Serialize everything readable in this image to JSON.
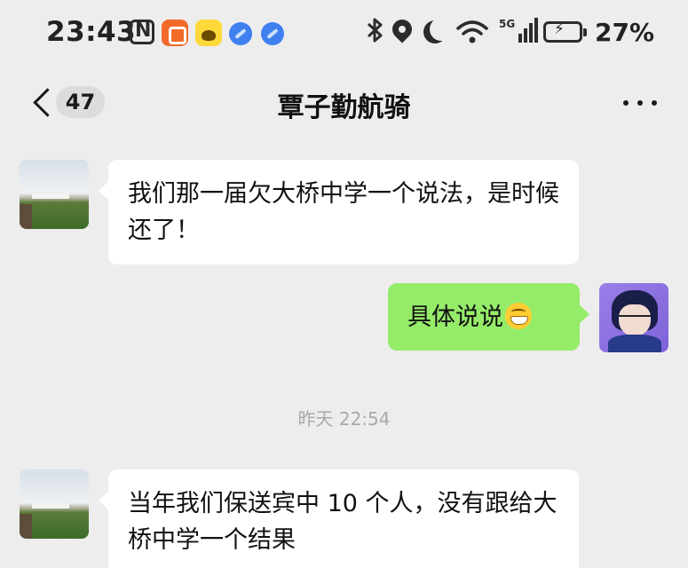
{
  "status_bar": {
    "time": "23:43",
    "battery_percent": "27%",
    "icons": [
      "nfc-icon",
      "app-icon-orange",
      "app-icon-yellow",
      "app-icon-blue",
      "app-icon-blue",
      "bluetooth-icon",
      "location-icon",
      "moon-icon",
      "wifi-icon",
      "signal-5g-icon",
      "battery-charging-icon"
    ]
  },
  "nav": {
    "unread_count": "47",
    "title": "覃子勤航骑"
  },
  "messages": [
    {
      "direction": "in",
      "text": "我们那一届欠大桥中学一个说法，是时候还了！"
    },
    {
      "direction": "out",
      "text": "具体说说",
      "emoji": "grin-emoji"
    },
    {
      "type": "timestamp",
      "text": "昨天 22:54"
    },
    {
      "direction": "in",
      "text": "当年我们保送宾中 10 个人，没有跟给大桥中学一个结果"
    }
  ],
  "colors": {
    "background": "#ededed",
    "incoming_bubble": "#ffffff",
    "outgoing_bubble": "#95ec69",
    "timestamp_text": "#a9a9a9"
  }
}
